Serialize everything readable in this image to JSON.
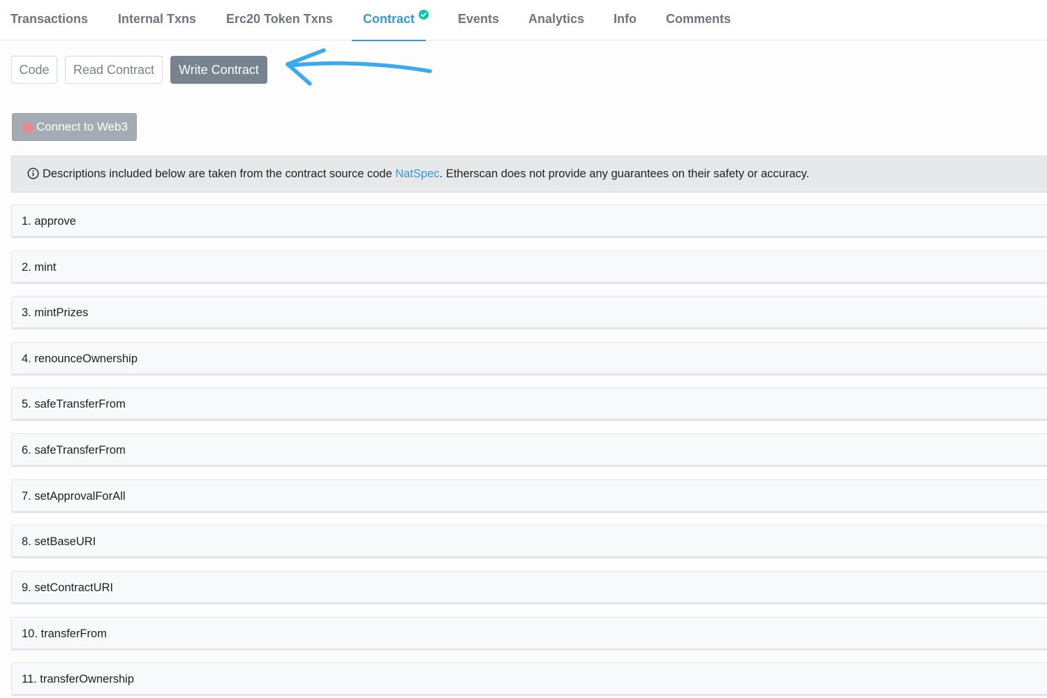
{
  "tabs": {
    "transactions": "Transactions",
    "internal_txns": "Internal Txns",
    "erc20_token_txns": "Erc20 Token Txns",
    "contract": "Contract",
    "events": "Events",
    "analytics": "Analytics",
    "info": "Info",
    "comments": "Comments",
    "active": "Contract"
  },
  "subtabs": {
    "code": "Code",
    "read_contract": "Read Contract",
    "write_contract": "Write Contract",
    "active": "Write Contract"
  },
  "connect_button": {
    "label": "Connect to Web3",
    "status_color": "#e98a8f"
  },
  "banner": {
    "text_before": "Descriptions included below are taken from the contract source code ",
    "link": "NatSpec",
    "text_after": ". Etherscan does not provide any guarantees on their safety or accuracy."
  },
  "functions": [
    "1. approve",
    "2. mint",
    "3. mintPrizes",
    "4. renounceOwnership",
    "5. safeTransferFrom",
    "6. safeTransferFrom",
    "7. setApprovalForAll",
    "8. setBaseURI",
    "9. setContractURI",
    "10. transferFrom",
    "11. transferOwnership"
  ],
  "colors": {
    "accent": "#3498db",
    "verified_check": "#00c9a7",
    "annotation_arrow": "#3aa9f0"
  },
  "annotation": {
    "icon": "arrow-pointing-left"
  }
}
